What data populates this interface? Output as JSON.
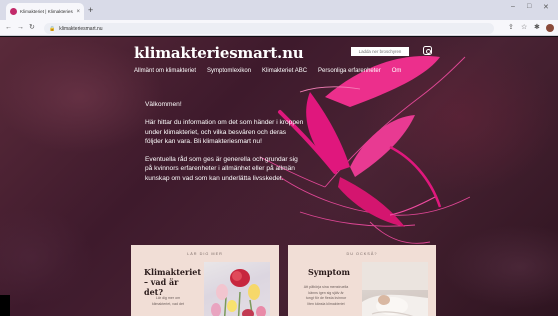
{
  "browser": {
    "tab_title": "Klimakteriet | Klimakteriesmart.nu",
    "tab_close": "×",
    "new_tab": "+",
    "url": "klimakteriesmart.nu",
    "window_controls": [
      "–",
      "□",
      "✕"
    ],
    "toolbar_icons": [
      "share-icon",
      "star-icon",
      "extensions-icon",
      "profile-avatar"
    ]
  },
  "site": {
    "logo": "klimakteriesmart.nu",
    "search_placeholder": "Ladda ner broschyren",
    "nav": [
      "Allmänt om klimakteriet",
      "Symptomlexikon",
      "Klimakteriet ABC",
      "Personliga erfarenheter",
      "Om"
    ]
  },
  "intro": {
    "greeting": "Välkommen!",
    "paragraph1": "Här hittar du information om det som händer i kroppen under klimakteriet, och vilka besvären och deras följder kan vara. Bli klimakteriesmart nu!",
    "paragraph2": "Eventuella råd som ges är generella och grundar sig på kvinnors erfarenheter i allmänhet eller på allmän kunskap om vad som kan underlätta livsskedet."
  },
  "cards": [
    {
      "kicker": "LÄR DIG MER",
      "title_line1": "Klimakteriet",
      "title_line2": "– vad är det?",
      "text_line1": "Lär dig mer om",
      "text_line2": "klimakteriet, vad det",
      "image": "tulips-photo"
    },
    {
      "kicker": "DU OCKSÅ?",
      "title_line1": "Symptom",
      "text_line1": "Att påbörja sina menstruella",
      "text_line2": "känns igen sig själv är",
      "text_line3": "tungt för de flesta kvinnor",
      "text_line4": "liten känsla klimakteriet",
      "image": "bedroom-photo"
    }
  ],
  "colors": {
    "accent": "#e0177d",
    "card_bg": "#f1ded6",
    "background": "#4a2334"
  }
}
